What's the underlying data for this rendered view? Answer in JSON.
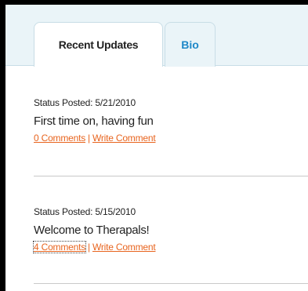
{
  "tabs": {
    "recent_updates": "Recent Updates",
    "bio": "Bio"
  },
  "updates": [
    {
      "status_posted": "Status Posted: 5/21/2010",
      "text": "First time on, having fun",
      "comments_link": "0 Comments",
      "separator": "|",
      "write_comment": "Write Comment"
    },
    {
      "status_posted": "Status Posted: 5/15/2010",
      "text": "Welcome to Therapals!",
      "comments_link": "4 Comments",
      "separator": "|",
      "write_comment": "Write Comment"
    }
  ],
  "colors": {
    "link": "#e8641e",
    "tab_background": "#eaf4f8",
    "bio_tab_text": "#1e88c8"
  }
}
